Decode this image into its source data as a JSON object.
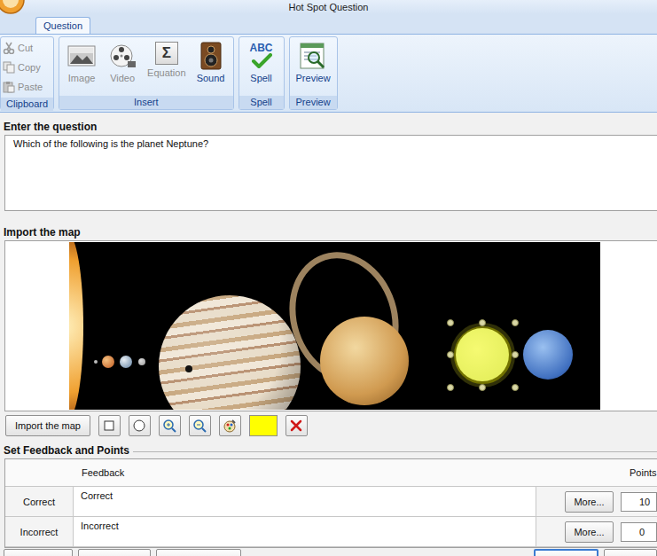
{
  "window": {
    "title": "Hot Spot Question"
  },
  "tabs": [
    {
      "label": "Question",
      "selected": true
    }
  ],
  "ribbon": [
    {
      "label": "Clipboard",
      "kind": "small",
      "items": [
        {
          "label": "Cut",
          "disabled": true
        },
        {
          "label": "Copy",
          "disabled": true
        },
        {
          "label": "Paste",
          "disabled": true
        }
      ]
    },
    {
      "label": "Insert",
      "kind": "large",
      "items": [
        {
          "label": "Image",
          "disabled": true
        },
        {
          "label": "Video",
          "disabled": true
        },
        {
          "label": "Equation",
          "disabled": true,
          "glyph": "Σ"
        },
        {
          "label": "Sound",
          "disabled": false
        }
      ]
    },
    {
      "label": "Spell",
      "kind": "large",
      "items": [
        {
          "label": "Spell",
          "disabled": false,
          "glyph": "ABC"
        }
      ]
    },
    {
      "label": "Preview",
      "kind": "large",
      "items": [
        {
          "label": "Preview",
          "disabled": false
        }
      ]
    }
  ],
  "question": {
    "label": "Enter the question",
    "text": "Which of the following is the planet Neptune?"
  },
  "map": {
    "label": "Import the map",
    "hotspot": {
      "selected": true
    },
    "toolbar": {
      "import_button": "Import the map",
      "fill_color": "#ffff00"
    }
  },
  "feedback": {
    "title": "Set Feedback and Points",
    "columns": [
      "Feedback",
      "Points"
    ],
    "rows": [
      {
        "label": "Correct",
        "feedback": "Correct",
        "more": "More...",
        "points": "10"
      },
      {
        "label": "Incorrect",
        "feedback": "Incorrect",
        "more": "More...",
        "points": "0"
      }
    ]
  },
  "footer": {
    "buttons": [
      {
        "default": false
      },
      {
        "default": false
      },
      {
        "default": false
      },
      {
        "default": true
      },
      {
        "default": false
      }
    ]
  }
}
